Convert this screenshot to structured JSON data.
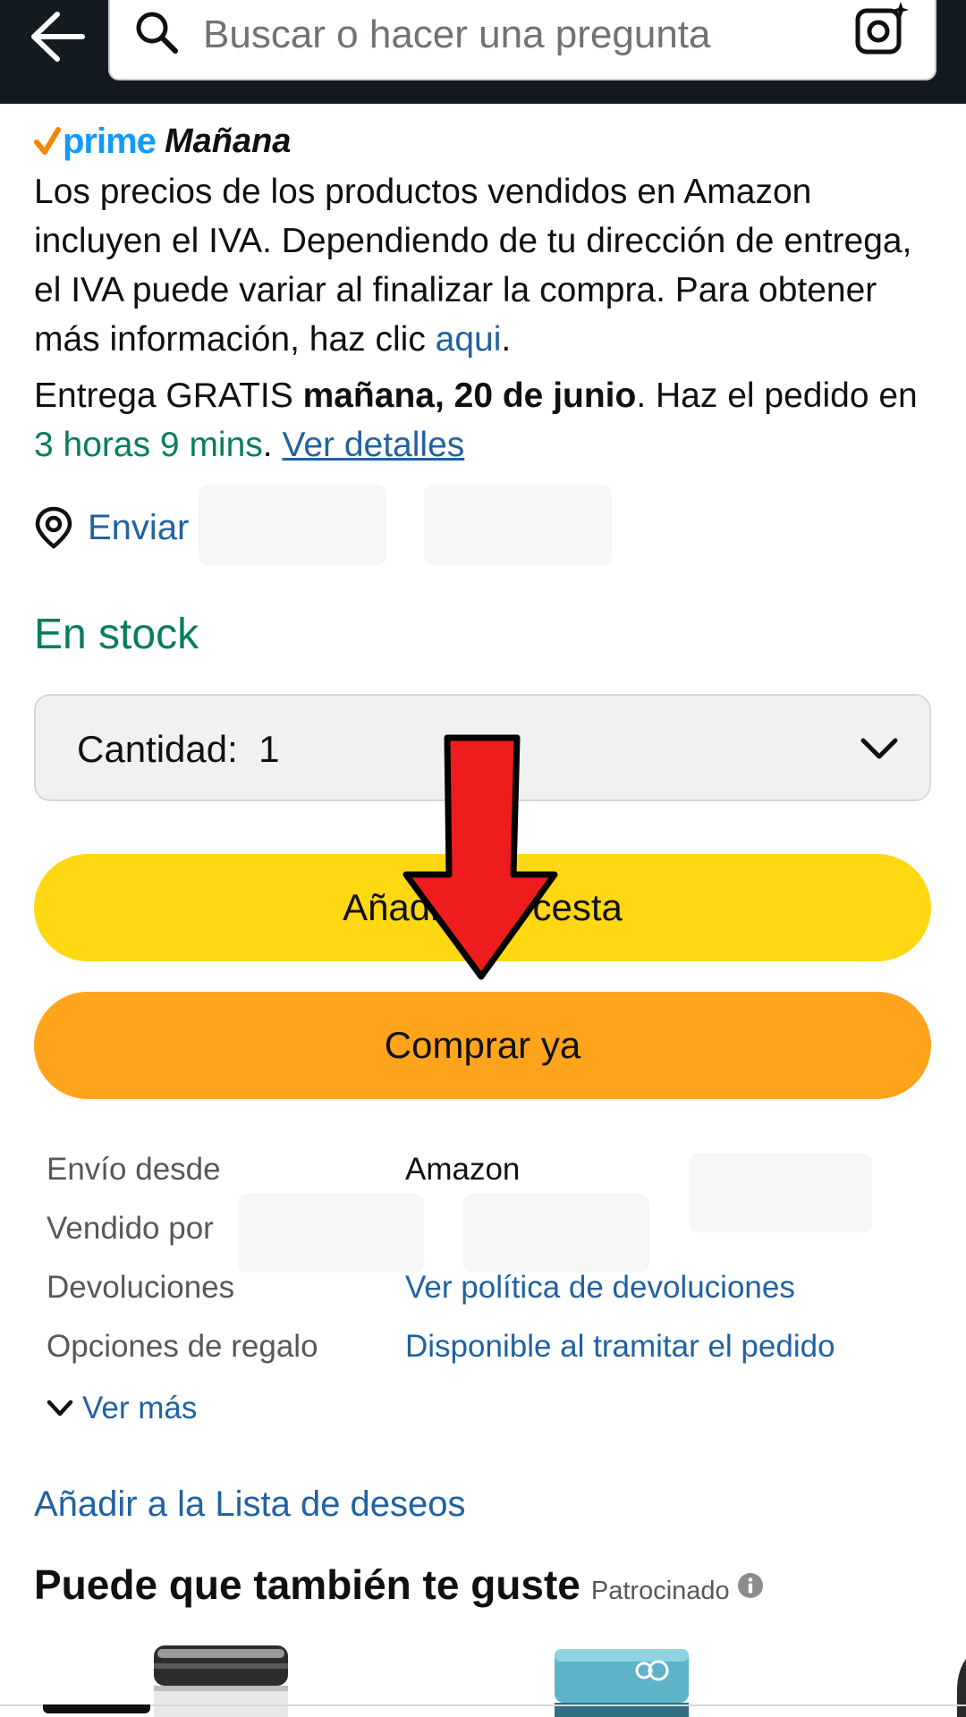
{
  "header": {
    "search_placeholder": "Buscar o hacer una pregunta"
  },
  "prime": {
    "brand": "prime",
    "delivery_day": "Mañana"
  },
  "vat_notice": {
    "text": "Los precios de los productos vendidos en Amazon incluyen el IVA. Dependiendo de tu dirección de entrega, el IVA puede variar al finalizar la compra. Para obtener más información, haz clic ",
    "link": "aqui",
    "end": "."
  },
  "delivery": {
    "prefix": "Entrega GRATIS ",
    "date": "mañana, 20 de junio",
    "middle": ". Haz el pedido en ",
    "countdown": "3 horas 9 mins",
    "sep": ". ",
    "details_link": "Ver detalles"
  },
  "ship_to": {
    "label": "Enviar"
  },
  "stock_status": "En stock",
  "quantity": {
    "label": "Cantidad:",
    "value": "1"
  },
  "buttons": {
    "add_to_cart": "Añadir a la cesta",
    "buy_now": "Comprar ya"
  },
  "details": {
    "ships_from_label": "Envío desde",
    "ships_from_value": "Amazon",
    "sold_by_label": "Vendido por",
    "returns_label": "Devoluciones",
    "returns_value": "Ver política de devoluciones",
    "gift_label": "Opciones de regalo",
    "gift_value": "Disponible al tramitar el pedido",
    "see_more": "Ver más"
  },
  "wishlist_link": "Añadir a la Lista de deseos",
  "suggestions": {
    "title": "Puede que también te guste",
    "sponsored": "Patrocinado"
  },
  "colors": {
    "header_bg": "#131a22",
    "link": "#2162a1",
    "in_stock": "#067d62",
    "add_to_cart_bg": "#ffd814",
    "buy_now_bg": "#ffa41c",
    "annotation_arrow": "#ee1c1c"
  }
}
